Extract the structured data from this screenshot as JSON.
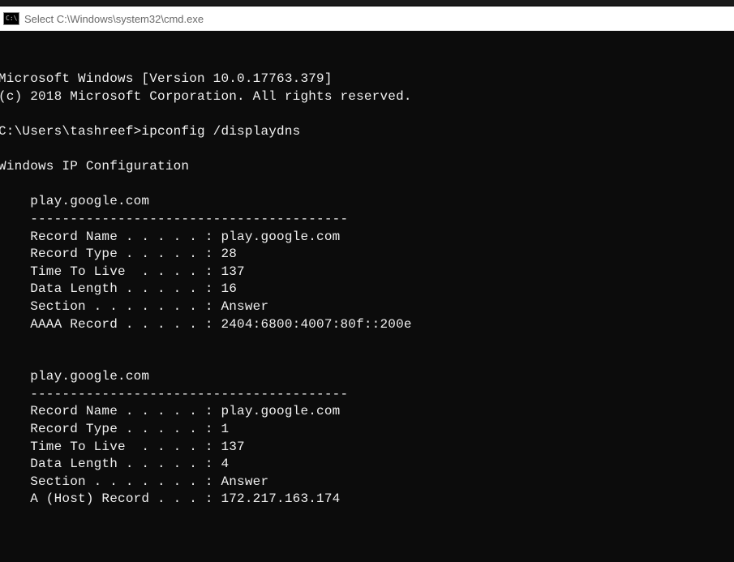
{
  "window": {
    "icon_label": "C:\\.",
    "title": "Select C:\\Windows\\system32\\cmd.exe"
  },
  "header": {
    "line1": "Microsoft Windows [Version 10.0.17763.379]",
    "line2": "(c) 2018 Microsoft Corporation. All rights reserved."
  },
  "prompt": {
    "path": "C:\\Users\\tashreef>",
    "command": "ipconfig /displaydns"
  },
  "section_title": "Windows IP Configuration",
  "records": [
    {
      "host": "play.google.com",
      "divider": "----------------------------------------",
      "fields": [
        {
          "label": "Record Name . . . . . :",
          "value": "play.google.com"
        },
        {
          "label": "Record Type . . . . . :",
          "value": "28"
        },
        {
          "label": "Time To Live  . . . . :",
          "value": "137"
        },
        {
          "label": "Data Length . . . . . :",
          "value": "16"
        },
        {
          "label": "Section . . . . . . . :",
          "value": "Answer"
        },
        {
          "label": "AAAA Record . . . . . :",
          "value": "2404:6800:4007:80f::200e"
        }
      ]
    },
    {
      "host": "play.google.com",
      "divider": "----------------------------------------",
      "fields": [
        {
          "label": "Record Name . . . . . :",
          "value": "play.google.com"
        },
        {
          "label": "Record Type . . . . . :",
          "value": "1"
        },
        {
          "label": "Time To Live  . . . . :",
          "value": "137"
        },
        {
          "label": "Data Length . . . . . :",
          "value": "4"
        },
        {
          "label": "Section . . . . . . . :",
          "value": "Answer"
        },
        {
          "label": "A (Host) Record . . . :",
          "value": "172.217.163.174"
        }
      ]
    }
  ]
}
